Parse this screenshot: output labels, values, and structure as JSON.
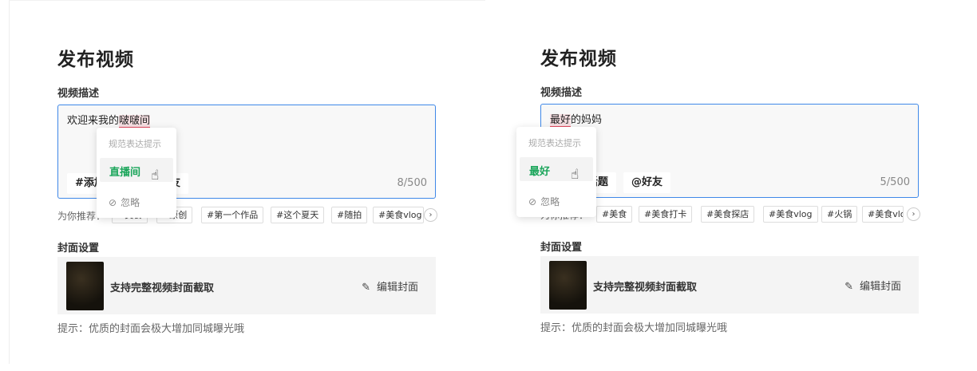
{
  "panels": [
    {
      "title": "发布视频",
      "desc_label": "视频描述",
      "desc_prefix": "欢迎来我的",
      "desc_highlight": "啵啵间",
      "desc_suffix": "",
      "chips": [
        "#添加话题",
        "@好友"
      ],
      "counter": "8/500",
      "suggest_label": "为你推荐：",
      "tags": [
        "#美食",
        "#原创",
        "#第一个作品",
        "#这个夏天",
        "#随拍",
        "#美食vlog"
      ],
      "popup": {
        "heading": "规范表达提示",
        "option": "直播间",
        "ignore": "忽略"
      },
      "cover_label": "封面设置",
      "cover_text": "支持完整视频封面截取",
      "edit_cover": "编辑封面",
      "hint": "提示：优质的封面会极大增加同城曝光哦"
    },
    {
      "title": "发布视频",
      "desc_label": "视频描述",
      "desc_prefix": "",
      "desc_highlight": "最好",
      "desc_suffix": "的妈妈",
      "chips": [
        "#添加话题",
        "@好友"
      ],
      "counter": "5/500",
      "suggest_label": "为你推荐：",
      "tags": [
        "#美食",
        "#美食打卡",
        "#美食探店",
        "#美食vlog",
        "#火锅",
        "#美食vlog"
      ],
      "popup": {
        "heading": "规范表达提示",
        "option": "最好",
        "ignore": "忽略"
      },
      "cover_label": "封面设置",
      "cover_text": "支持完整视频封面截取",
      "edit_cover": "编辑封面",
      "hint": "提示：优质的封面会极大增加同城曝光哦"
    }
  ],
  "colors": {
    "accent_blue": "#3f88e8",
    "highlight_red": "#e0475c",
    "suggest_green": "#1aa55a"
  },
  "icons": {
    "pencil": "pencil-icon",
    "eye_off": "eye-off-icon",
    "chevron": "chevron-right-icon",
    "cursor": "hand-cursor-icon"
  }
}
